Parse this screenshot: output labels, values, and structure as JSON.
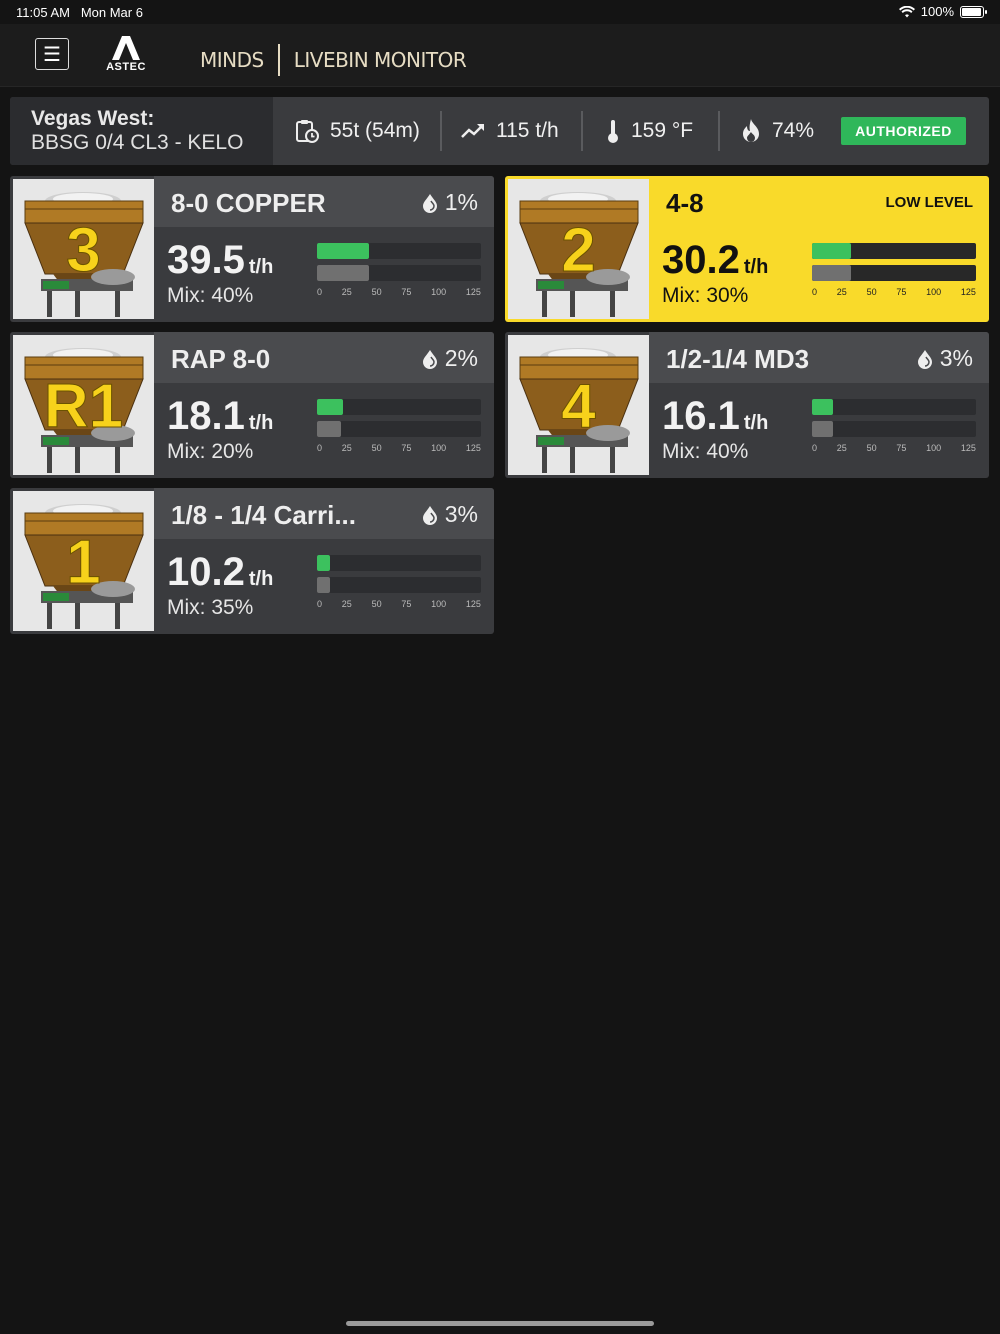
{
  "status": {
    "time": "11:05 AM",
    "date": "Mon Mar 6",
    "battery": "100%",
    "battery_level": 1.0
  },
  "header": {
    "logo": "ASTEC",
    "app": "MINDS",
    "module": "LIVEBIN MONITOR"
  },
  "info": {
    "site_name": "Vegas West:",
    "job": "BBSG 0/4 CL3 - KELO",
    "tons": "55t (54m)",
    "rate": "115 t/h",
    "temp": "159 °F",
    "burner": "74%",
    "status_label": "AUTHORIZED"
  },
  "colors": {
    "accent_green": "#2fb75a",
    "alert_yellow": "#f9da2a",
    "bar_green": "#3cc15e",
    "bar_gray": "#707070"
  },
  "bar_scale": {
    "max": 125,
    "ticks": [
      "0",
      "25",
      "50",
      "75",
      "100",
      "125"
    ]
  },
  "bins": [
    {
      "number": "3",
      "name": "8-0 COPPER",
      "moisture": "1%",
      "rate": "39.5",
      "unit": "t/h",
      "mix": "Mix: 40%",
      "actual_bar": 40,
      "target_bar": 40,
      "alert": false
    },
    {
      "number": "2",
      "name": "4-8",
      "alert_label": "LOW LEVEL",
      "rate": "30.2",
      "unit": "t/h",
      "mix": "Mix: 30%",
      "actual_bar": 30,
      "target_bar": 30,
      "alert": true
    },
    {
      "number": "R1",
      "name": "RAP 8-0",
      "moisture": "2%",
      "rate": "18.1",
      "unit": "t/h",
      "mix": "Mix: 20%",
      "actual_bar": 20,
      "target_bar": 18,
      "alert": false
    },
    {
      "number": "4",
      "name": "1/2-1/4 MD3",
      "moisture": "3%",
      "rate": "16.1",
      "unit": "t/h",
      "mix": "Mix: 40%",
      "actual_bar": 16,
      "target_bar": 16,
      "alert": false
    },
    {
      "number": "1",
      "name": "1/8 - 1/4 Carri...",
      "moisture": "3%",
      "rate": "10.2",
      "unit": "t/h",
      "mix": "Mix: 35%",
      "actual_bar": 10,
      "target_bar": 10,
      "alert": false
    }
  ]
}
